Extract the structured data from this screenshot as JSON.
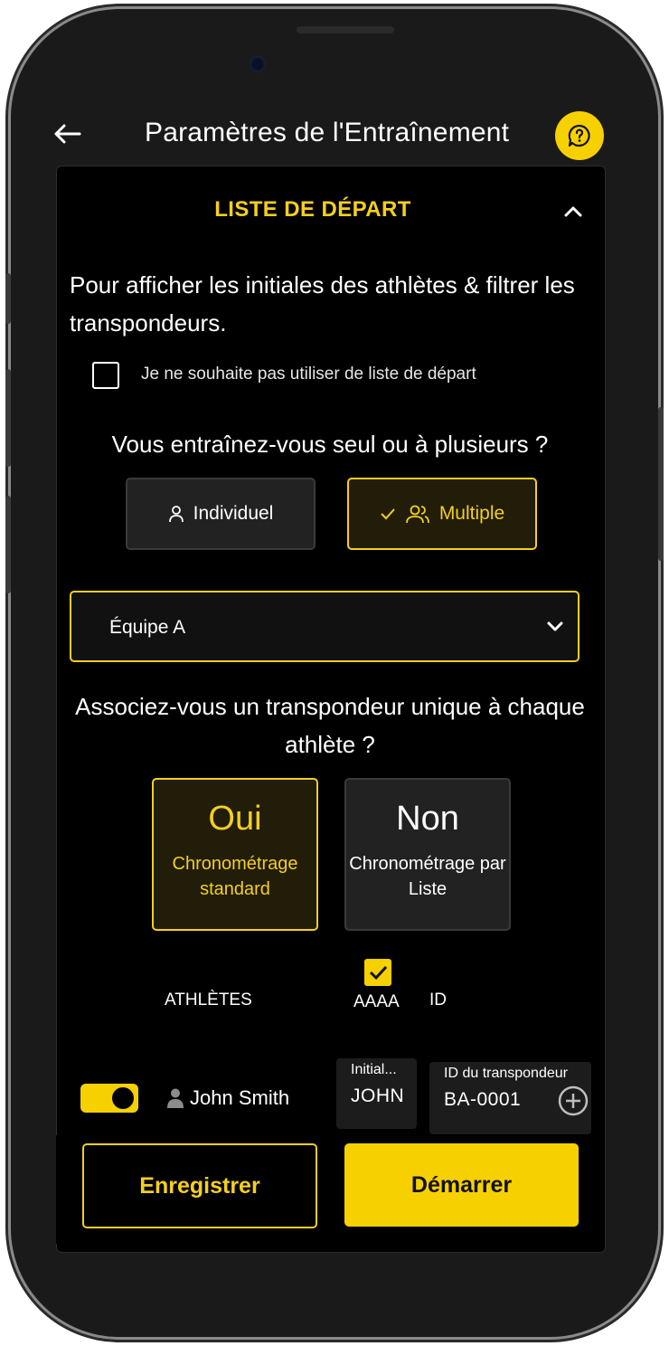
{
  "header": {
    "title": "Paramètres de l'Entraînement",
    "back_icon": "arrow-left-icon",
    "help_icon": "help-chat-icon"
  },
  "section": {
    "title": "LISTE DE DÉPART",
    "collapse_icon": "chevron-up-icon"
  },
  "intro_text": "Pour afficher les initiales des athlètes & filtrer les transpondeurs.",
  "no_start_list": {
    "label": "Je ne souhaite pas utiliser de liste de départ",
    "checked": false
  },
  "training_mode": {
    "question": "Vous entraînez-vous seul ou à plusieurs ?",
    "individual_label": "Individuel",
    "multiple_label": "Multiple",
    "selected": "Multiple"
  },
  "team_select": {
    "value": "Équipe A"
  },
  "transponder_question": "Associez-vous un transpondeur unique à chaque athlète ?",
  "timing_options": {
    "oui": {
      "title": "Oui",
      "subtitle": "Chronométrage standard"
    },
    "non": {
      "title": "Non",
      "subtitle": "Chronométrage par Liste"
    },
    "selected": "Oui"
  },
  "athlete_table": {
    "col_athletes": "ATHLÈTES",
    "col_initials": "AAAA",
    "col_id": "ID",
    "initials_checked": true
  },
  "athlete_row": {
    "enabled": true,
    "name": "John Smith",
    "initials_label": "Initial...",
    "initials_value": "JOHN",
    "transponder_label": "ID du transpondeur",
    "transponder_value": "BA-0001"
  },
  "actions": {
    "save_label": "Enregistrer",
    "start_label": "Démarrer"
  },
  "colors": {
    "accent": "#f7d000",
    "background": "#000000",
    "card_dark": "#222222"
  }
}
